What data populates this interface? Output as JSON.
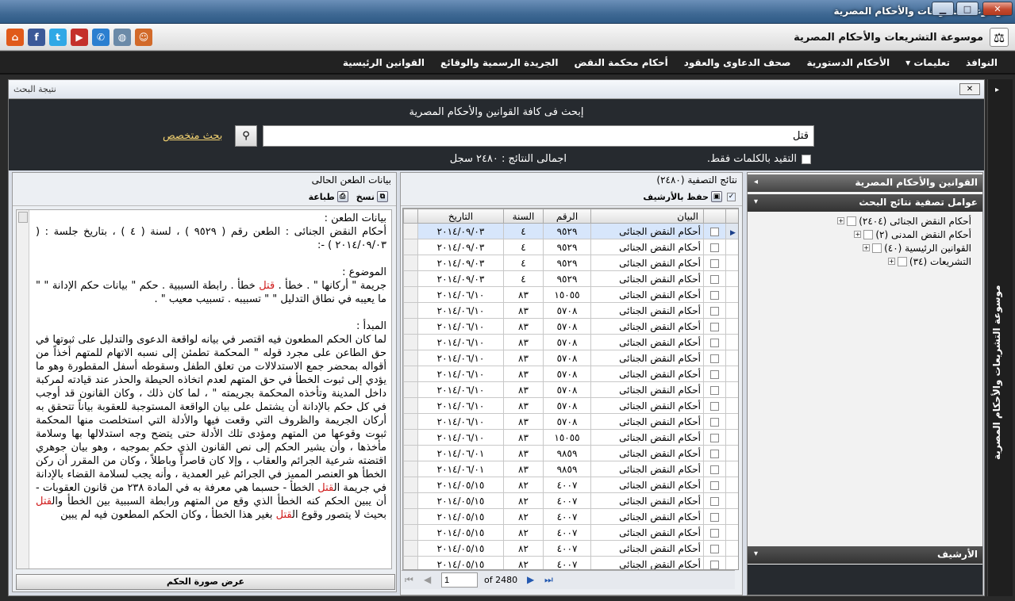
{
  "window": {
    "title": "موسوعة التشريعات والأحكام المصرية",
    "minimize": "▁",
    "maximize": "□",
    "close": "✕"
  },
  "header": {
    "app_title": "موسوعة التشريعات والأحكام المصرية",
    "social": [
      {
        "icon": "home-icon",
        "glyph": "⌂",
        "color": "#e05a1a"
      },
      {
        "icon": "facebook-icon",
        "glyph": "f",
        "color": "#3b5998"
      },
      {
        "icon": "twitter-icon",
        "glyph": "t",
        "color": "#2fa8e6"
      },
      {
        "icon": "youtube-icon",
        "glyph": "▶",
        "color": "#c4302b"
      },
      {
        "icon": "phone-icon",
        "glyph": "✆",
        "color": "#2b7fd0"
      },
      {
        "icon": "globe-icon",
        "glyph": "◍",
        "color": "#6b8aa8"
      },
      {
        "icon": "support-agent-icon",
        "glyph": "☺",
        "color": "#d26a2a"
      }
    ]
  },
  "menu": {
    "items": [
      "القوانين الرئيسية",
      "الجريدة الرسمية والوقائع",
      "أحكام محكمة النقض",
      "صحف الدعاوى والعقود",
      "الأحكام الدستورية",
      "تعليمات ▾",
      "النوافذ"
    ]
  },
  "panel": {
    "title": "نتيجة البحث",
    "close_glyph": "✕"
  },
  "search": {
    "heading": "إبحث فى كافة القوانين والأحكام المصرية",
    "query": "قتل",
    "advanced_link": "بحث متخصص",
    "exact_label": "التقيد بالكلمات فقط.",
    "total_label": "اجمالى النتائج :  ٢٤٨٠ سجل"
  },
  "sidebar": {
    "laws_header": "القوانين والأحكام المصرية",
    "filter_header": "عوامل تصفية نتائج البحث",
    "tree": [
      "أحكام النقض الجنائى (٢٤٠٤)",
      "أحكام النقض المدنى (٢)",
      "القوانين الرئيسية (٤٠)",
      "التشريعات (٣٤)"
    ],
    "archive_header": "الأرشيف"
  },
  "grid": {
    "caption": "نتائج التصفية (٢٤٨٠)",
    "save_archive": "حفظ بالأرشيف",
    "columns": [
      "البيان",
      "الرقم",
      "السنة",
      "التاريخ"
    ],
    "rows": [
      [
        "أحكام النقض الجنائى",
        "٩٥٢٩",
        "٤",
        "٢٠١٤/٠٩/٠٣"
      ],
      [
        "أحكام النقض الجنائى",
        "٩٥٢٩",
        "٤",
        "٢٠١٤/٠٩/٠٣"
      ],
      [
        "أحكام النقض الجنائى",
        "٩٥٢٩",
        "٤",
        "٢٠١٤/٠٩/٠٣"
      ],
      [
        "أحكام النقض الجنائى",
        "٩٥٢٩",
        "٤",
        "٢٠١٤/٠٩/٠٣"
      ],
      [
        "أحكام النقض الجنائى",
        "١٥٠٥٥",
        "٨٣",
        "٢٠١٤/٠٦/١٠"
      ],
      [
        "أحكام النقض الجنائى",
        "٥٧٠٨",
        "٨٣",
        "٢٠١٤/٠٦/١٠"
      ],
      [
        "أحكام النقض الجنائى",
        "٥٧٠٨",
        "٨٣",
        "٢٠١٤/٠٦/١٠"
      ],
      [
        "أحكام النقض الجنائى",
        "٥٧٠٨",
        "٨٣",
        "٢٠١٤/٠٦/١٠"
      ],
      [
        "أحكام النقض الجنائى",
        "٥٧٠٨",
        "٨٣",
        "٢٠١٤/٠٦/١٠"
      ],
      [
        "أحكام النقض الجنائى",
        "٥٧٠٨",
        "٨٣",
        "٢٠١٤/٠٦/١٠"
      ],
      [
        "أحكام النقض الجنائى",
        "٥٧٠٨",
        "٨٣",
        "٢٠١٤/٠٦/١٠"
      ],
      [
        "أحكام النقض الجنائى",
        "٥٧٠٨",
        "٨٣",
        "٢٠١٤/٠٦/١٠"
      ],
      [
        "أحكام النقض الجنائى",
        "٥٧٠٨",
        "٨٣",
        "٢٠١٤/٠٦/١٠"
      ],
      [
        "أحكام النقض الجنائى",
        "١٥٠٥٥",
        "٨٣",
        "٢٠١٤/٠٦/١٠"
      ],
      [
        "أحكام النقض الجنائى",
        "٩٨٥٩",
        "٨٣",
        "٢٠١٤/٠٦/٠١"
      ],
      [
        "أحكام النقض الجنائى",
        "٩٨٥٩",
        "٨٣",
        "٢٠١٤/٠٦/٠١"
      ],
      [
        "أحكام النقض الجنائى",
        "٤٠٠٧",
        "٨٢",
        "٢٠١٤/٠٥/١٥"
      ],
      [
        "أحكام النقض الجنائى",
        "٤٠٠٧",
        "٨٢",
        "٢٠١٤/٠٥/١٥"
      ],
      [
        "أحكام النقض الجنائى",
        "٤٠٠٧",
        "٨٢",
        "٢٠١٤/٠٥/١٥"
      ],
      [
        "أحكام النقض الجنائى",
        "٤٠٠٧",
        "٨٢",
        "٢٠١٤/٠٥/١٥"
      ],
      [
        "أحكام النقض الجنائى",
        "٤٠٠٧",
        "٨٢",
        "٢٠١٤/٠٥/١٥"
      ],
      [
        "أحكام النقض الجنائى",
        "٤٠٠٧",
        "٨٢",
        "٢٠١٤/٠٥/١٥"
      ]
    ],
    "pager_page": "1",
    "pager_of": "of 2480"
  },
  "detail": {
    "caption": "بيانات الطعن الحالى",
    "print_label": "طباعة",
    "copy_label": "نسخ",
    "view_image": "عرض صورة الحكم",
    "case_header": "بيانات الطعن :",
    "case_line": "أحكام النقض الجنائى : الطعن رقم   ( ٩٥٢٩ )  ، لسنة  ( ٤ )  ، بتاريخ جلسة :  ( ٢٠١٤/٠٩/٠٣ )  -:",
    "subject_header": "الموضوع :",
    "subject_text_a": "جريمة \" أركانها \" . خطأ . ",
    "subject_kw": "قتل",
    "subject_text_b": " خطأ . رابطة السببية . حكم \" بيانات حكم الإدانة \" \" ما يعيبه في نطاق التدليل \" \" تسبيبه . تسبيب معيب \" .",
    "principle_header": "المبدأ :",
    "principle_a": "لما كان الحكم المطعون فيه اقتصر في بيانه لواقعة الدعوى والتدليل على ثبوتها في حق الطاعن على مجرد قوله \" المحكمة تطمئن إلى نسبه الاتهام للمتهم أخذاً من أقواله بمحضر جمع الاستدلالات من تعلق الطفل وسقوطه أسفل المقطورة وهو ما يؤدي إلى ثبوت الخطأ في حق المتهم لعدم اتخاذه الحيطة والحذر عند قيادته لمركبة داخل المدينة وتأخذه المحكمة بجريمته \" ، لما كان ذلك ، وكان القانون قد أوجب في كل حكم بالإدانة أن يشتمل على بيان الواقعة المستوجبة للعقوبة بياناً تتحقق به أركان الجريمة والظروف التي وقعت فيها والأدلة التي استخلصت منها المحكمة ثبوت وقوعها من المتهم ومؤدى تلك الأدلة حتى يتضح وجه استدلالها بها وسلامة مأخذها ، وأن يشير الحكم إلى نص القانون الذي حكم بموجبه ، وهو بيان جوهري اقتضته شرعية الجرائم والعقاب ، وإلا كان قاصراً وباطلاً ، وكان من المقرر أن ركن الخطأ هو العنصر المميز في الجرائم غير العمدية ، وأنه يجب لسلامة القضاء بالإدانة في جريمة ال",
    "principle_kw1": "قتل",
    "principle_b": " الخطأ - حسبما هي معرفة به في المادة ٢٣٨ من قانون العقوبات - أن يبين الحكم كنه الخطأ الذي وقع من المتهم ورابطة السببية بين الخطأ وال",
    "principle_kw2": "قتل",
    "principle_c": " بحيث لا يتصور وقوع ال",
    "principle_kw3": "قتل",
    "principle_d": " بغير هذا الخطأ ، وكان الحكم المطعون فيه لم يبين"
  },
  "vtab": {
    "label": "موسوعة التشريعات والأحكام المصرية"
  }
}
